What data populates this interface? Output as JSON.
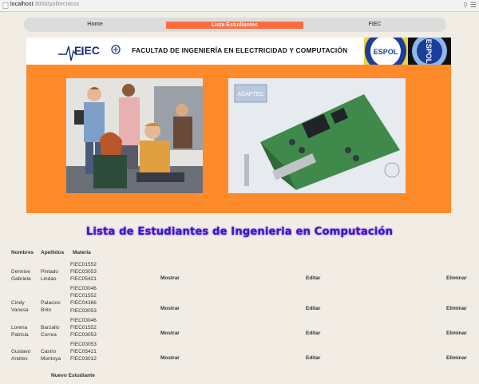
{
  "browser": {
    "url_host": "localhost",
    "url_path": ":3000/politecnicos"
  },
  "nav": {
    "items": [
      "Home",
      "Lista Estudiantes",
      "FIEC"
    ],
    "active": "Lista Estudiantes",
    "colors": {
      "bar": "#dcdcdc",
      "active": "#ff6a3d"
    }
  },
  "banner": {
    "title": "FACULTAD DE INGENIERÍA EN ELECTRICIDAD Y COMPUTACIÓN",
    "logo_text": "FIEC",
    "espol_text": "ESPOL"
  },
  "hero": {
    "color": "#ff8a2a",
    "right_image_label": "ADAPTEC"
  },
  "heading": "Lista de Estudiantes de Ingenieria en Computación",
  "table": {
    "headers": [
      "Nombres",
      "Apellidos",
      "Materia"
    ],
    "actions": [
      "Mostrar",
      "Editar",
      "Eliminar"
    ],
    "rows": [
      {
        "nombres": [
          "Dennise",
          "Gabriela"
        ],
        "apellidos": [
          "Pintado",
          "Lindao"
        ],
        "materias": [
          "FIEC01552",
          "FIEC03053",
          "FIEC05421"
        ]
      },
      {
        "nombres": [
          "Cindy",
          "Vanesa"
        ],
        "apellidos": [
          "Palacios",
          "Brito"
        ],
        "materias": [
          "FIEC03046",
          "FIEC01552",
          "FIEC04366",
          "FIEC03053"
        ]
      },
      {
        "nombres": [
          "Lorena",
          "Patricia"
        ],
        "apellidos": [
          "Barzallo",
          "Correa"
        ],
        "materias": [
          "FIEC03046",
          "FIEC01552",
          "FIEC03053"
        ]
      },
      {
        "nombres": [
          "Gustavo",
          "Andres"
        ],
        "apellidos": [
          "Castro",
          "Montoya"
        ],
        "materias": [
          "FIEC03053",
          "FIEC05421",
          "FIEC03012"
        ]
      }
    ]
  },
  "new_student_label": "Nuevo Estudiante"
}
